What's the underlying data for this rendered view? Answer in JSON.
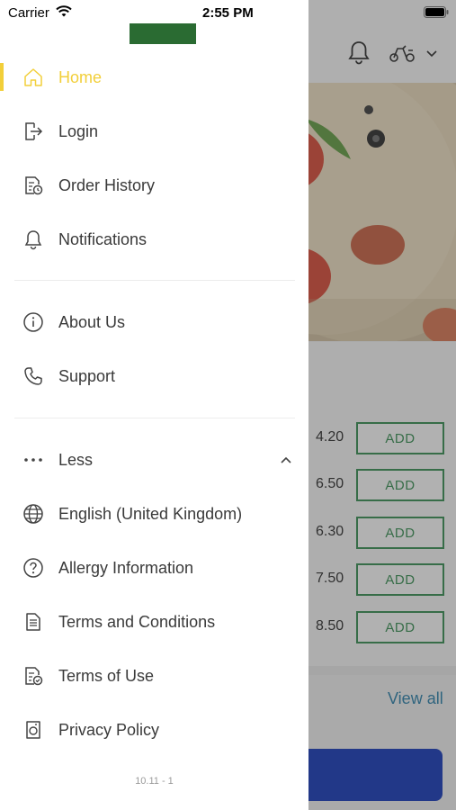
{
  "status_bar": {
    "carrier": "Carrier",
    "time": "2:55 PM"
  },
  "drawer": {
    "active_color": "#f2cf3a",
    "items_primary": [
      {
        "label": "Home",
        "icon": "home-icon",
        "active": true
      },
      {
        "label": "Login",
        "icon": "login-icon"
      },
      {
        "label": "Order History",
        "icon": "order-history-icon"
      },
      {
        "label": "Notifications",
        "icon": "bell-icon"
      }
    ],
    "items_secondary": [
      {
        "label": "About Us",
        "icon": "info-icon"
      },
      {
        "label": "Support",
        "icon": "phone-icon"
      }
    ],
    "items_more": [
      {
        "label": "Less",
        "icon": "more-dots-icon"
      },
      {
        "label": "English (United Kingdom)",
        "icon": "globe-icon"
      },
      {
        "label": "Allergy Information",
        "icon": "question-icon"
      },
      {
        "label": "Terms and Conditions",
        "icon": "document-icon"
      },
      {
        "label": "Terms of Use",
        "icon": "document-check-icon"
      },
      {
        "label": "Privacy Policy",
        "icon": "privacy-icon"
      }
    ],
    "version": "10.11 - 1"
  },
  "background": {
    "prices": [
      "4.20",
      "6.50",
      "6.30",
      "7.50",
      "8.50"
    ],
    "add_label": "ADD",
    "view_all": "View all",
    "accent_green": "#2d8a4a",
    "bottom_button_color": "#0a2fb8"
  }
}
